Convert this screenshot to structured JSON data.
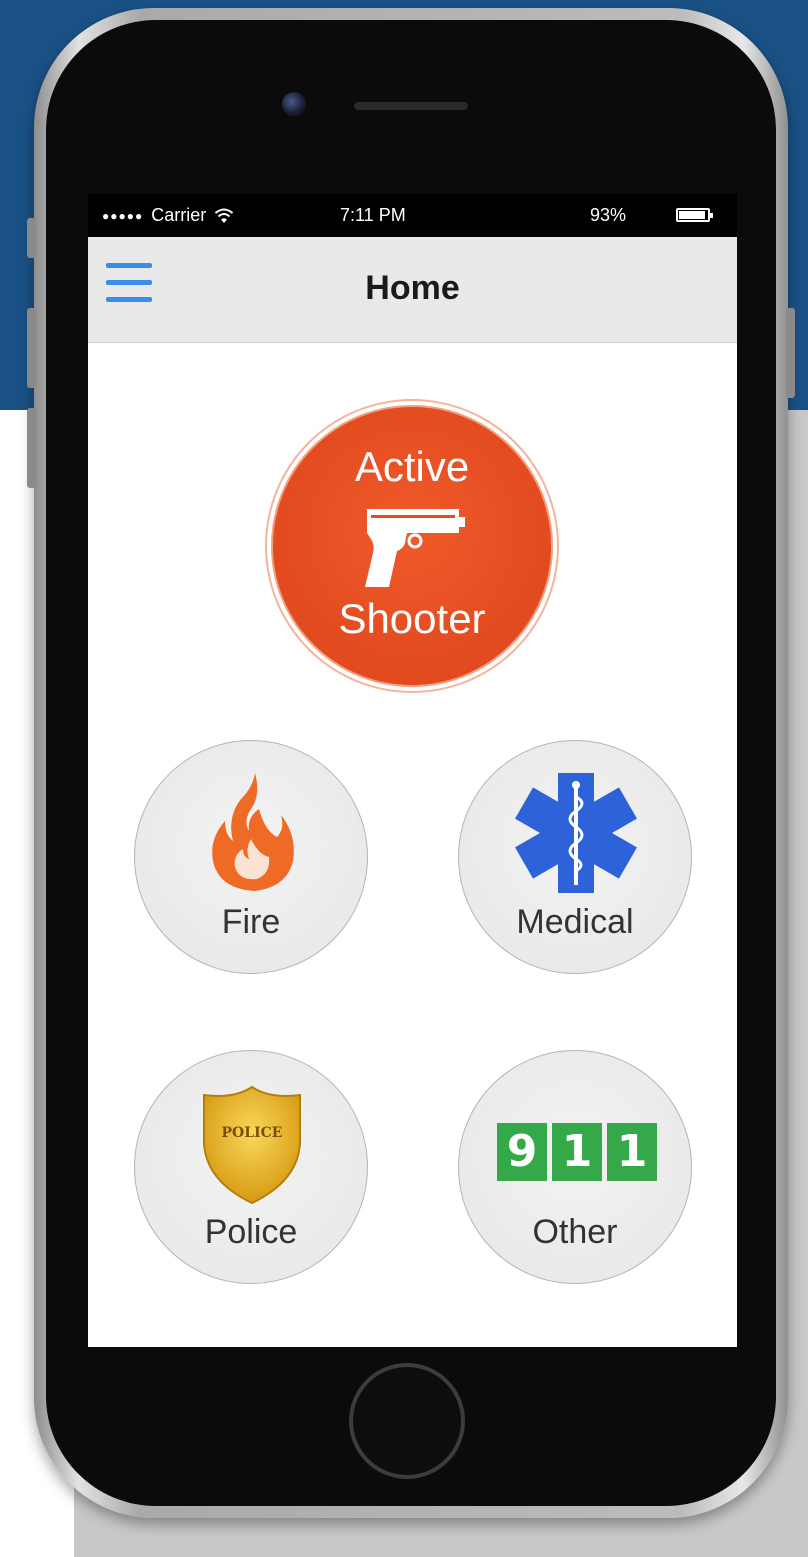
{
  "status_bar": {
    "signal": "●●●●●",
    "carrier": "Carrier",
    "time": "7:11 PM",
    "battery": "93%"
  },
  "nav": {
    "title": "Home",
    "menu_icon": "hamburger-menu-icon"
  },
  "buttons": {
    "active_shooter": {
      "line1": "Active",
      "line2": "Shooter",
      "icon": "handgun-icon",
      "color": "#e24a1f"
    },
    "fire": {
      "label": "Fire",
      "icon": "flame-icon",
      "color": "#ef6a24"
    },
    "medical": {
      "label": "Medical",
      "icon": "star-of-life-icon",
      "color": "#2d62d8"
    },
    "police": {
      "label": "Police",
      "icon": "police-badge-icon",
      "badge_text": "POLICE",
      "color": "#e8b41d"
    },
    "other": {
      "label": "Other",
      "icon": "911-icon",
      "digits": [
        "9",
        "1",
        "1"
      ],
      "color": "#35a84a"
    }
  }
}
